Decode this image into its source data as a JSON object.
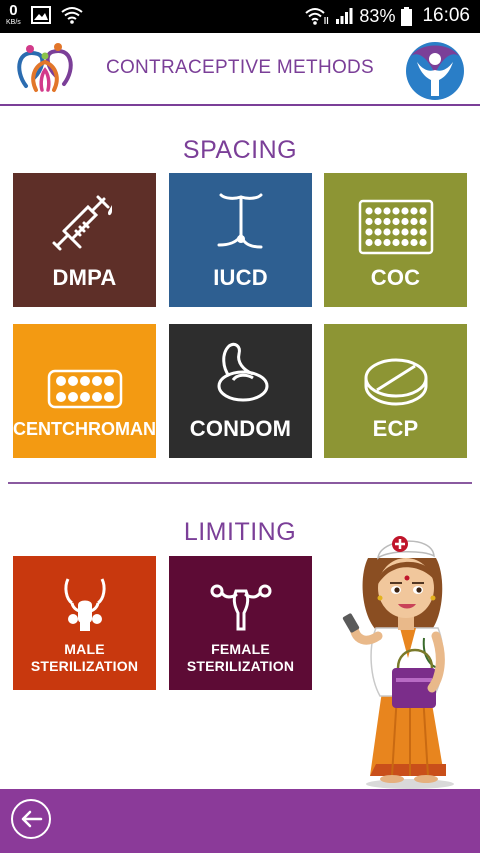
{
  "status_bar": {
    "speed_value": "0",
    "speed_unit": "KB/s",
    "battery_percent": "83%",
    "time": "16:06"
  },
  "header": {
    "title": "CONTRACEPTIVE METHODS"
  },
  "sections": {
    "spacing": {
      "title": "SPACING",
      "tiles": [
        {
          "label": "DMPA",
          "color": "#5e2f28",
          "icon": "syringe-icon"
        },
        {
          "label": "IUCD",
          "color": "#2e5f91",
          "icon": "iucd-icon"
        },
        {
          "label": "COC",
          "color": "#8d9534",
          "icon": "pill-pack-icon"
        },
        {
          "label": "CENTCHROMAN",
          "color": "#f39a12",
          "icon": "pill-strip-icon"
        },
        {
          "label": "CONDOM",
          "color": "#2d2d2d",
          "icon": "condom-icon"
        },
        {
          "label": "ECP",
          "color": "#8d9534",
          "icon": "tablet-icon"
        }
      ]
    },
    "limiting": {
      "title": "LIMITING",
      "tiles": [
        {
          "label_line1": "MALE",
          "label_line2": "STERILIZATION",
          "color": "#c8380e",
          "icon": "male-reproductive-icon"
        },
        {
          "label_line1": "FEMALE",
          "label_line2": "STERILIZATION",
          "color": "#5d0b35",
          "icon": "uterus-icon"
        }
      ]
    }
  },
  "colors": {
    "brand_purple": "#7b3f98",
    "bottom_bar": "#8b3a99"
  }
}
